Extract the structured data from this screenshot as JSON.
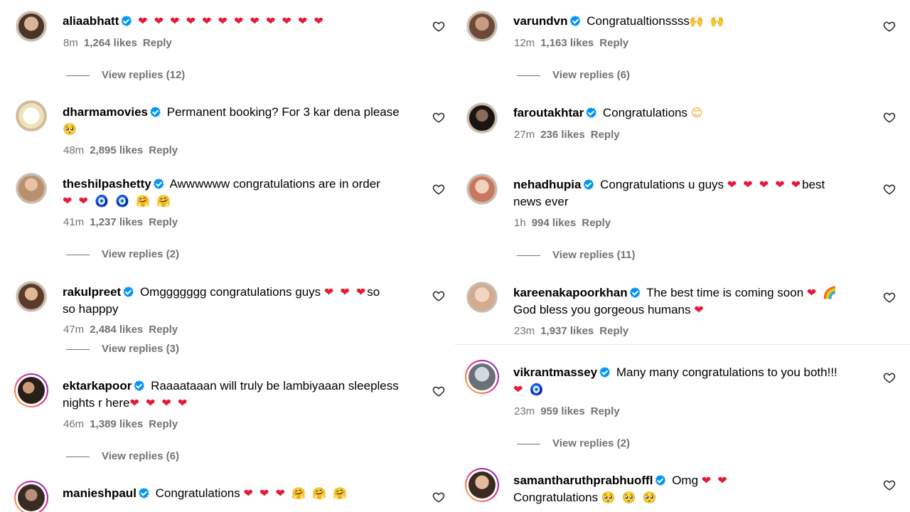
{
  "left": [
    {
      "user": "aliaabhatt",
      "text": "",
      "emoji": "❤ ❤ ❤ ❤ ❤ ❤ ❤ ❤ ❤ ❤ ❤ ❤",
      "emoji2": "",
      "time": "8m",
      "likes": "1,264 likes",
      "reply": "Reply",
      "view_replies": "View replies (12)"
    },
    {
      "user": "dharmamovies",
      "text": "Permanent booking? For 3 kar dena please",
      "emoji": "",
      "emoji2": "🥺",
      "time": "48m",
      "likes": "2,895 likes",
      "reply": "Reply",
      "view_replies": ""
    },
    {
      "user": "theshilpashetty",
      "text": "Awwwwww congratulations are in order",
      "emoji": "",
      "emoji2": "❤ ❤ 🧿 🧿 🤗 🤗",
      "time": "41m",
      "likes": "1,237 likes",
      "reply": "Reply",
      "view_replies": "View replies (2)"
    },
    {
      "user": "rakulpreet",
      "text": "Omggggggg congratulations guys",
      "emoji": "❤ ❤ ❤",
      "text_tail": "so",
      "line2": "so happpy",
      "time": "47m",
      "likes": "2,484 likes",
      "reply": "Reply",
      "view_replies": "View replies (3)"
    },
    {
      "user": "ektarkapoor",
      "text": "Raaaataaan will truly be lambiyaaan sleepless",
      "line2": "nights r here",
      "emoji2": "❤ ❤ ❤ ❤",
      "time": "46m",
      "likes": "1,389 likes",
      "reply": "Reply",
      "view_replies": "View replies (6)"
    },
    {
      "user": "manieshpaul",
      "text": "Congratulations",
      "emoji": "❤ ❤ ❤ 🤗 🤗 🤗"
    }
  ],
  "right": [
    {
      "user": "varundvn",
      "text": "Congratualtionssss",
      "emoji": "🙌 🙌",
      "time": "12m",
      "likes": "1,163 likes",
      "reply": "Reply",
      "view_replies": "View replies (6)"
    },
    {
      "user": "faroutakhtar",
      "text": "Congratulations",
      "emoji": "😊",
      "time": "27m",
      "likes": "236 likes",
      "reply": "Reply"
    },
    {
      "user": "nehadhupia",
      "text": "Congratulations u guys",
      "emoji": "❤ ❤ ❤ ❤ ❤",
      "text_tail": "best",
      "line2": "news ever",
      "time": "1h",
      "likes": "994 likes",
      "reply": "Reply",
      "view_replies": "View replies (11)"
    },
    {
      "user": "kareenakapoorkhan",
      "text": "The best time is coming soon",
      "emoji": "❤ 🌈",
      "line2": "God bless you gorgeous humans",
      "emoji2": "❤",
      "time": "23m",
      "likes": "1,937 likes",
      "reply": "Reply"
    },
    {
      "user": "vikrantmassey",
      "text": "Many many congratulations to you both!!!",
      "emoji2": "❤ 🧿",
      "time": "23m",
      "likes": "959 likes",
      "reply": "Reply",
      "view_replies": "View replies (2)"
    },
    {
      "user": "samantharuthprabhuoffl",
      "text": "Omg",
      "emoji": "❤ ❤",
      "line2": "Congratulations",
      "emoji2": "🥺 🥺 🥺"
    }
  ],
  "icons": {
    "like": "heart-outline-icon",
    "verified": "verified-badge-icon"
  },
  "colors": {
    "verified": "#0095f6",
    "meta": "#737373",
    "heart": "#e41b3a"
  }
}
